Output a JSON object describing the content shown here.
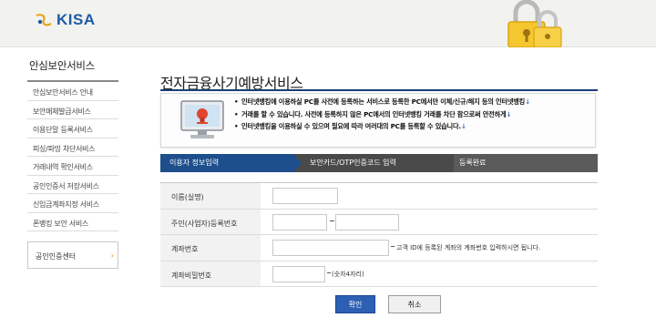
{
  "header": {
    "logo_text": "KISA"
  },
  "sidebar": {
    "title": "안심보안서비스",
    "items": [
      {
        "label": "안심보안서비스 안내"
      },
      {
        "label": "보안매체발급서비스"
      },
      {
        "label": "이용단말 등록서비스"
      },
      {
        "label": "피싱/파밍 차단서비스"
      },
      {
        "label": "거래내역 확인서비스"
      },
      {
        "label": "공인인증서 저장서비스"
      },
      {
        "label": "신입금계좌지정 서비스"
      },
      {
        "label": "폰뱅킹 보안 서비스"
      }
    ],
    "box": {
      "label": "공인인증센터",
      "arrow": "›"
    }
  },
  "main": {
    "title": "전자금융사기예방서비스",
    "info_bullets": [
      "인터넷뱅킹에 이용하실 PC를 사전에 등록하는 서비스로 등록한 PC에서만 이체/신규/해지 등의 인터넷뱅킹",
      "거래를 할 수 있습니다. 사전에 등록하지 않은 PC에서의 인터넷뱅킹 거래를 차단 함으로써 안전하게",
      "인터넷뱅킹을 이용하실 수 있으며 필요에 따라 여러대의 PC를 등록할 수 있습니다."
    ],
    "steps": [
      "이용자 정보입력",
      "보안카드/OTP인증코드 입력",
      "등록완료"
    ],
    "form": {
      "name_label": "이름(실명)",
      "name_value": "",
      "rrn_label": "주민(사업자)등록번호",
      "rrn_first": "",
      "rrn_second": "",
      "account_label": "계좌번호",
      "account_value": "",
      "account_hint": "고객 ID에 등록된 계좌의 계좌번호 입력하시면 됩니다.",
      "password_label": "계좌비밀번호",
      "password_value": "",
      "password_hint": "(숫자4자리)"
    },
    "buttons": {
      "confirm": "확인",
      "cancel": "취소"
    }
  },
  "colors": {
    "brand": "#1d5aa7",
    "step_active": "#1d4f8c",
    "step_inactive": "#4a4a4a",
    "confirm_button": "#2d5fb3",
    "accent_orange": "#e87b18"
  }
}
